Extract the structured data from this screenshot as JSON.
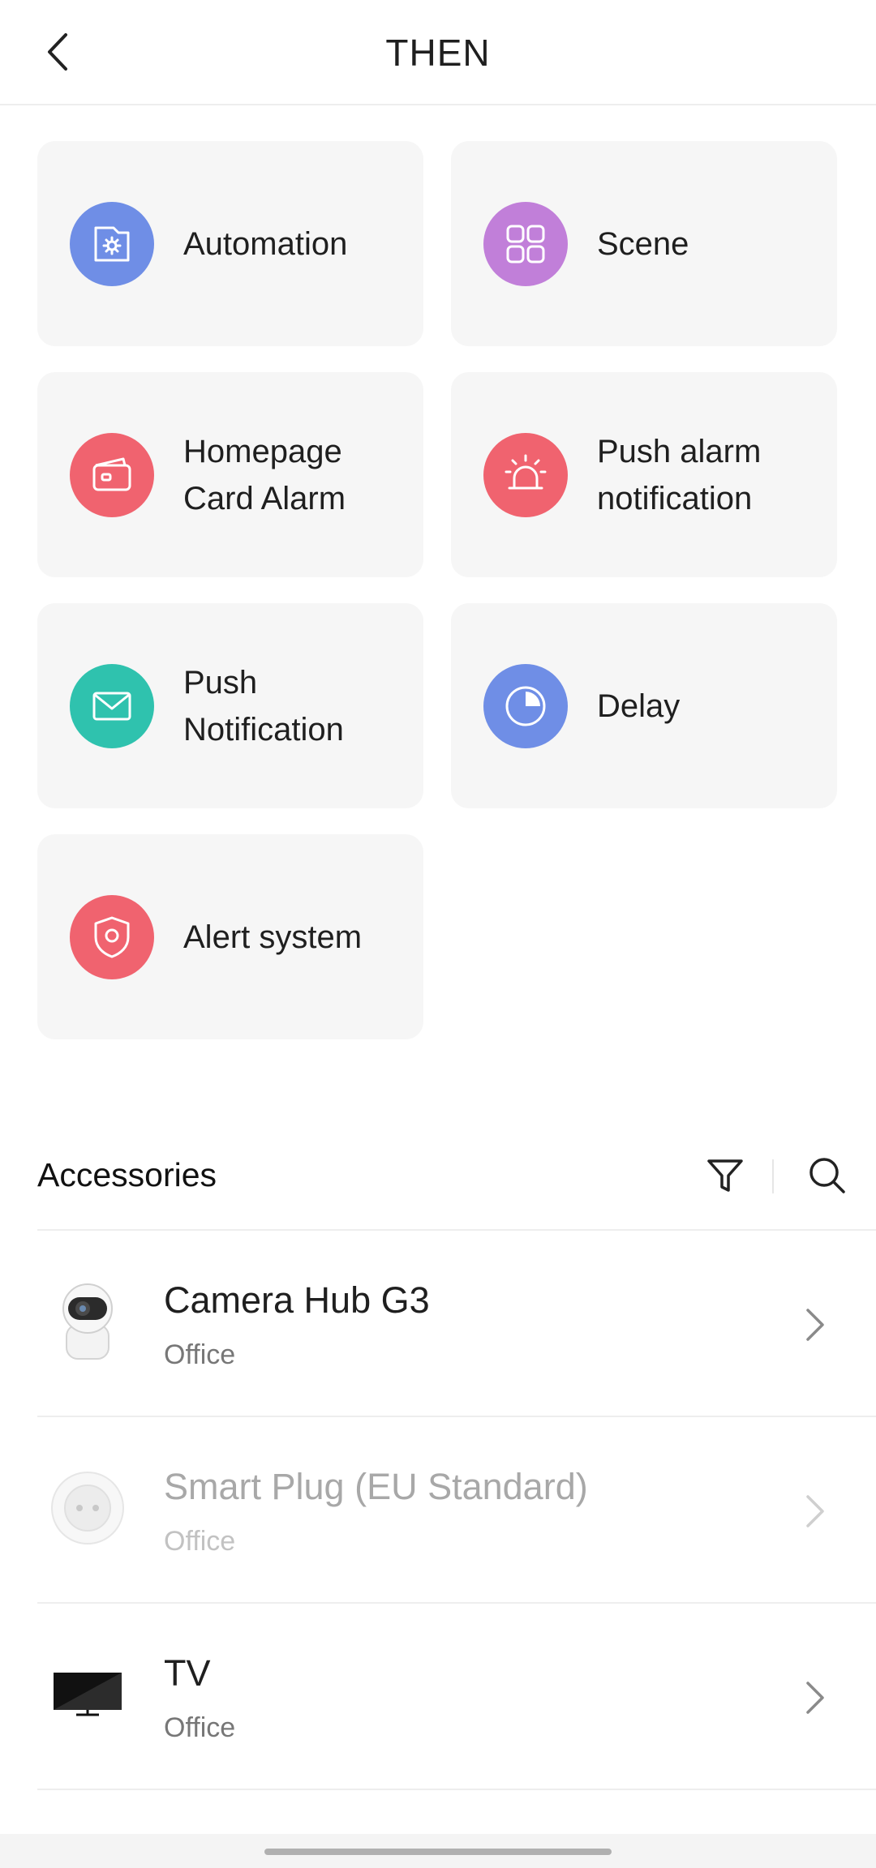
{
  "header": {
    "title": "THEN"
  },
  "actions": [
    {
      "label": "Automation",
      "icon": "automation-icon",
      "color": "#6f8ee6"
    },
    {
      "label": "Scene",
      "icon": "scene-grid-icon",
      "color": "#c17fd9"
    },
    {
      "label": "Homepage\nCard Alarm",
      "icon": "wallet-card-icon",
      "color": "#f0636f"
    },
    {
      "label": "Push alarm\nnotification",
      "icon": "siren-icon",
      "color": "#f0636f"
    },
    {
      "label": "Push\nNotification",
      "icon": "envelope-icon",
      "color": "#2fc2ae"
    },
    {
      "label": "Delay",
      "icon": "clock-pie-icon",
      "color": "#6f8ee6"
    },
    {
      "label": "Alert system",
      "icon": "shield-icon",
      "color": "#f0636f"
    }
  ],
  "accessories": {
    "title": "Accessories",
    "items": [
      {
        "name": "Camera Hub G3",
        "room": "Office",
        "enabled": true
      },
      {
        "name": "Smart Plug (EU Standard)",
        "room": "Office",
        "enabled": false
      },
      {
        "name": "TV",
        "room": "Office",
        "enabled": true
      }
    ]
  }
}
